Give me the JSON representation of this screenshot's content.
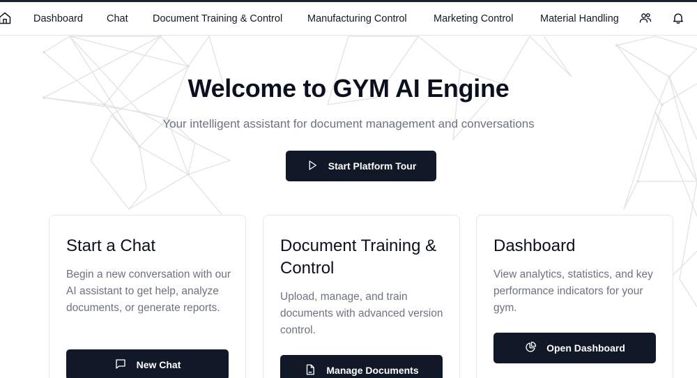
{
  "nav": {
    "items": [
      {
        "label": "Dashboard"
      },
      {
        "label": "Chat"
      },
      {
        "label": "Document Training & Control"
      },
      {
        "label": "Manufacturing Control"
      },
      {
        "label": "Marketing Control"
      },
      {
        "label": "Material Handling"
      }
    ],
    "icons": {
      "home": "home-icon",
      "users": "users-icon",
      "notifications": "bell-icon"
    }
  },
  "hero": {
    "title": "Welcome to GYM AI Engine",
    "subtitle": "Your intelligent assistant for document management and conversations",
    "tour_button": "Start Platform Tour"
  },
  "cards": [
    {
      "title": "Start a Chat",
      "description": "Begin a new conversation with our AI assistant to get help, analyze documents, or generate reports.",
      "button": "New Chat",
      "icon": "message-square-icon"
    },
    {
      "title": "Document Training & Control",
      "description": "Upload, manage, and train documents with advanced version control.",
      "button": "Manage Documents",
      "icon": "file-icon"
    },
    {
      "title": "Dashboard",
      "description": "View analytics, statistics, and key performance indicators for your gym.",
      "button": "Open Dashboard",
      "icon": "pie-chart-icon"
    }
  ],
  "colors": {
    "primary": "#111827",
    "text": "#0b1020",
    "muted": "#6b7280",
    "border": "#e5e7eb",
    "background": "#ffffff",
    "decorative_lines": "#e2e2e4"
  }
}
